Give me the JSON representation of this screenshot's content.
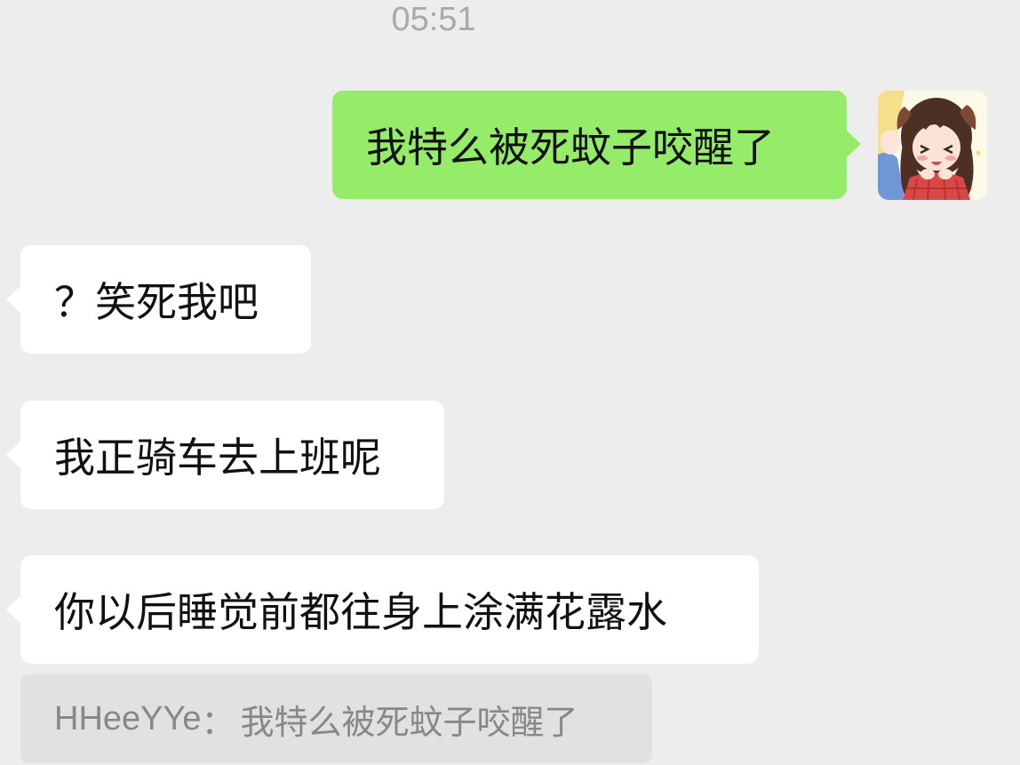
{
  "timestamp": "05:51",
  "outgoing_message": "我特么被死蚊子咬醒了",
  "incoming_messages": [
    "？笑死我吧",
    "我正骑车去上班呢",
    "你以后睡觉前都往身上涂满花露水"
  ],
  "quote": {
    "sender": "HHeeYYe",
    "separator": "：",
    "text": "我特么被死蚊子咬醒了"
  },
  "colors": {
    "background": "#ededed",
    "outgoing_bubble": "#95ec69",
    "incoming_bubble": "#ffffff",
    "quote_background": "#e1e1e1",
    "timestamp_text": "#a9a9a9"
  },
  "icons": {
    "avatar": "anime-girl-avatar"
  }
}
